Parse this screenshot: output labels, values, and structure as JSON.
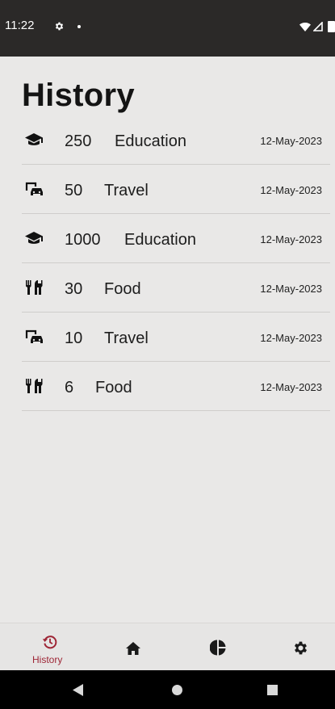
{
  "status_bar": {
    "time": "11:22"
  },
  "page": {
    "title": "History"
  },
  "history": [
    {
      "icon": "graduation-cap-icon",
      "amount": "250",
      "category": "Education",
      "date": "12-May-2023"
    },
    {
      "icon": "taxi-icon",
      "amount": "50",
      "category": "Travel",
      "date": "12-May-2023"
    },
    {
      "icon": "graduation-cap-icon",
      "amount": "1000",
      "category": "Education",
      "date": "12-May-2023"
    },
    {
      "icon": "utensils-icon",
      "amount": "30",
      "category": "Food",
      "date": "12-May-2023"
    },
    {
      "icon": "taxi-icon",
      "amount": "10",
      "category": "Travel",
      "date": "12-May-2023"
    },
    {
      "icon": "utensils-icon",
      "amount": "6",
      "category": "Food",
      "date": "12-May-2023"
    }
  ],
  "bottom_nav": {
    "active": "history",
    "items": [
      {
        "id": "history",
        "label": "History",
        "icon": "history-icon"
      },
      {
        "id": "home",
        "label": "",
        "icon": "home-icon"
      },
      {
        "id": "stats",
        "label": "",
        "icon": "pie-chart-icon"
      },
      {
        "id": "settings",
        "label": "",
        "icon": "gear-icon"
      }
    ]
  },
  "colors": {
    "accent": "#9e2636",
    "status_bar": "#2b2928",
    "background": "#e9e8e7"
  }
}
